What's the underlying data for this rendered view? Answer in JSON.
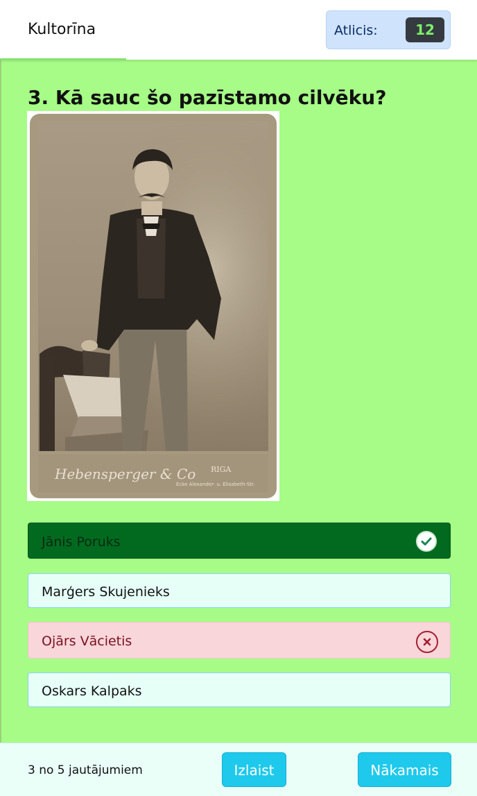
{
  "header": {
    "brand": "Kultorīna",
    "timer_label": "Atlicis:",
    "timer_value": "12"
  },
  "question": {
    "title": "3. Kā sauc šo pazīstamo cilvēku?",
    "photo_caption_left": "Hebensperger & Co",
    "photo_caption_city": "RIGA",
    "photo_caption_right": "Ecke Alexander- u. Elisabeth-Str."
  },
  "answers": [
    {
      "label": "Jānis Poruks",
      "state": "correct",
      "icon": "check-circle-icon"
    },
    {
      "label": "Marģers Skujenieks",
      "state": "neutral"
    },
    {
      "label": "Ojārs Vācietis",
      "state": "wrong",
      "icon": "x-circle-icon"
    },
    {
      "label": "Oskars Kalpaks",
      "state": "neutral"
    }
  ],
  "footer": {
    "progress": "3 no 5 jautājumiem",
    "skip_label": "Izlaist",
    "next_label": "Nākamais"
  },
  "colors": {
    "background": "#a6fc86",
    "correct": "#016a1f",
    "wrong": "#f8d6da",
    "neutral": "#e6fff7",
    "button": "#1fc9ec"
  }
}
